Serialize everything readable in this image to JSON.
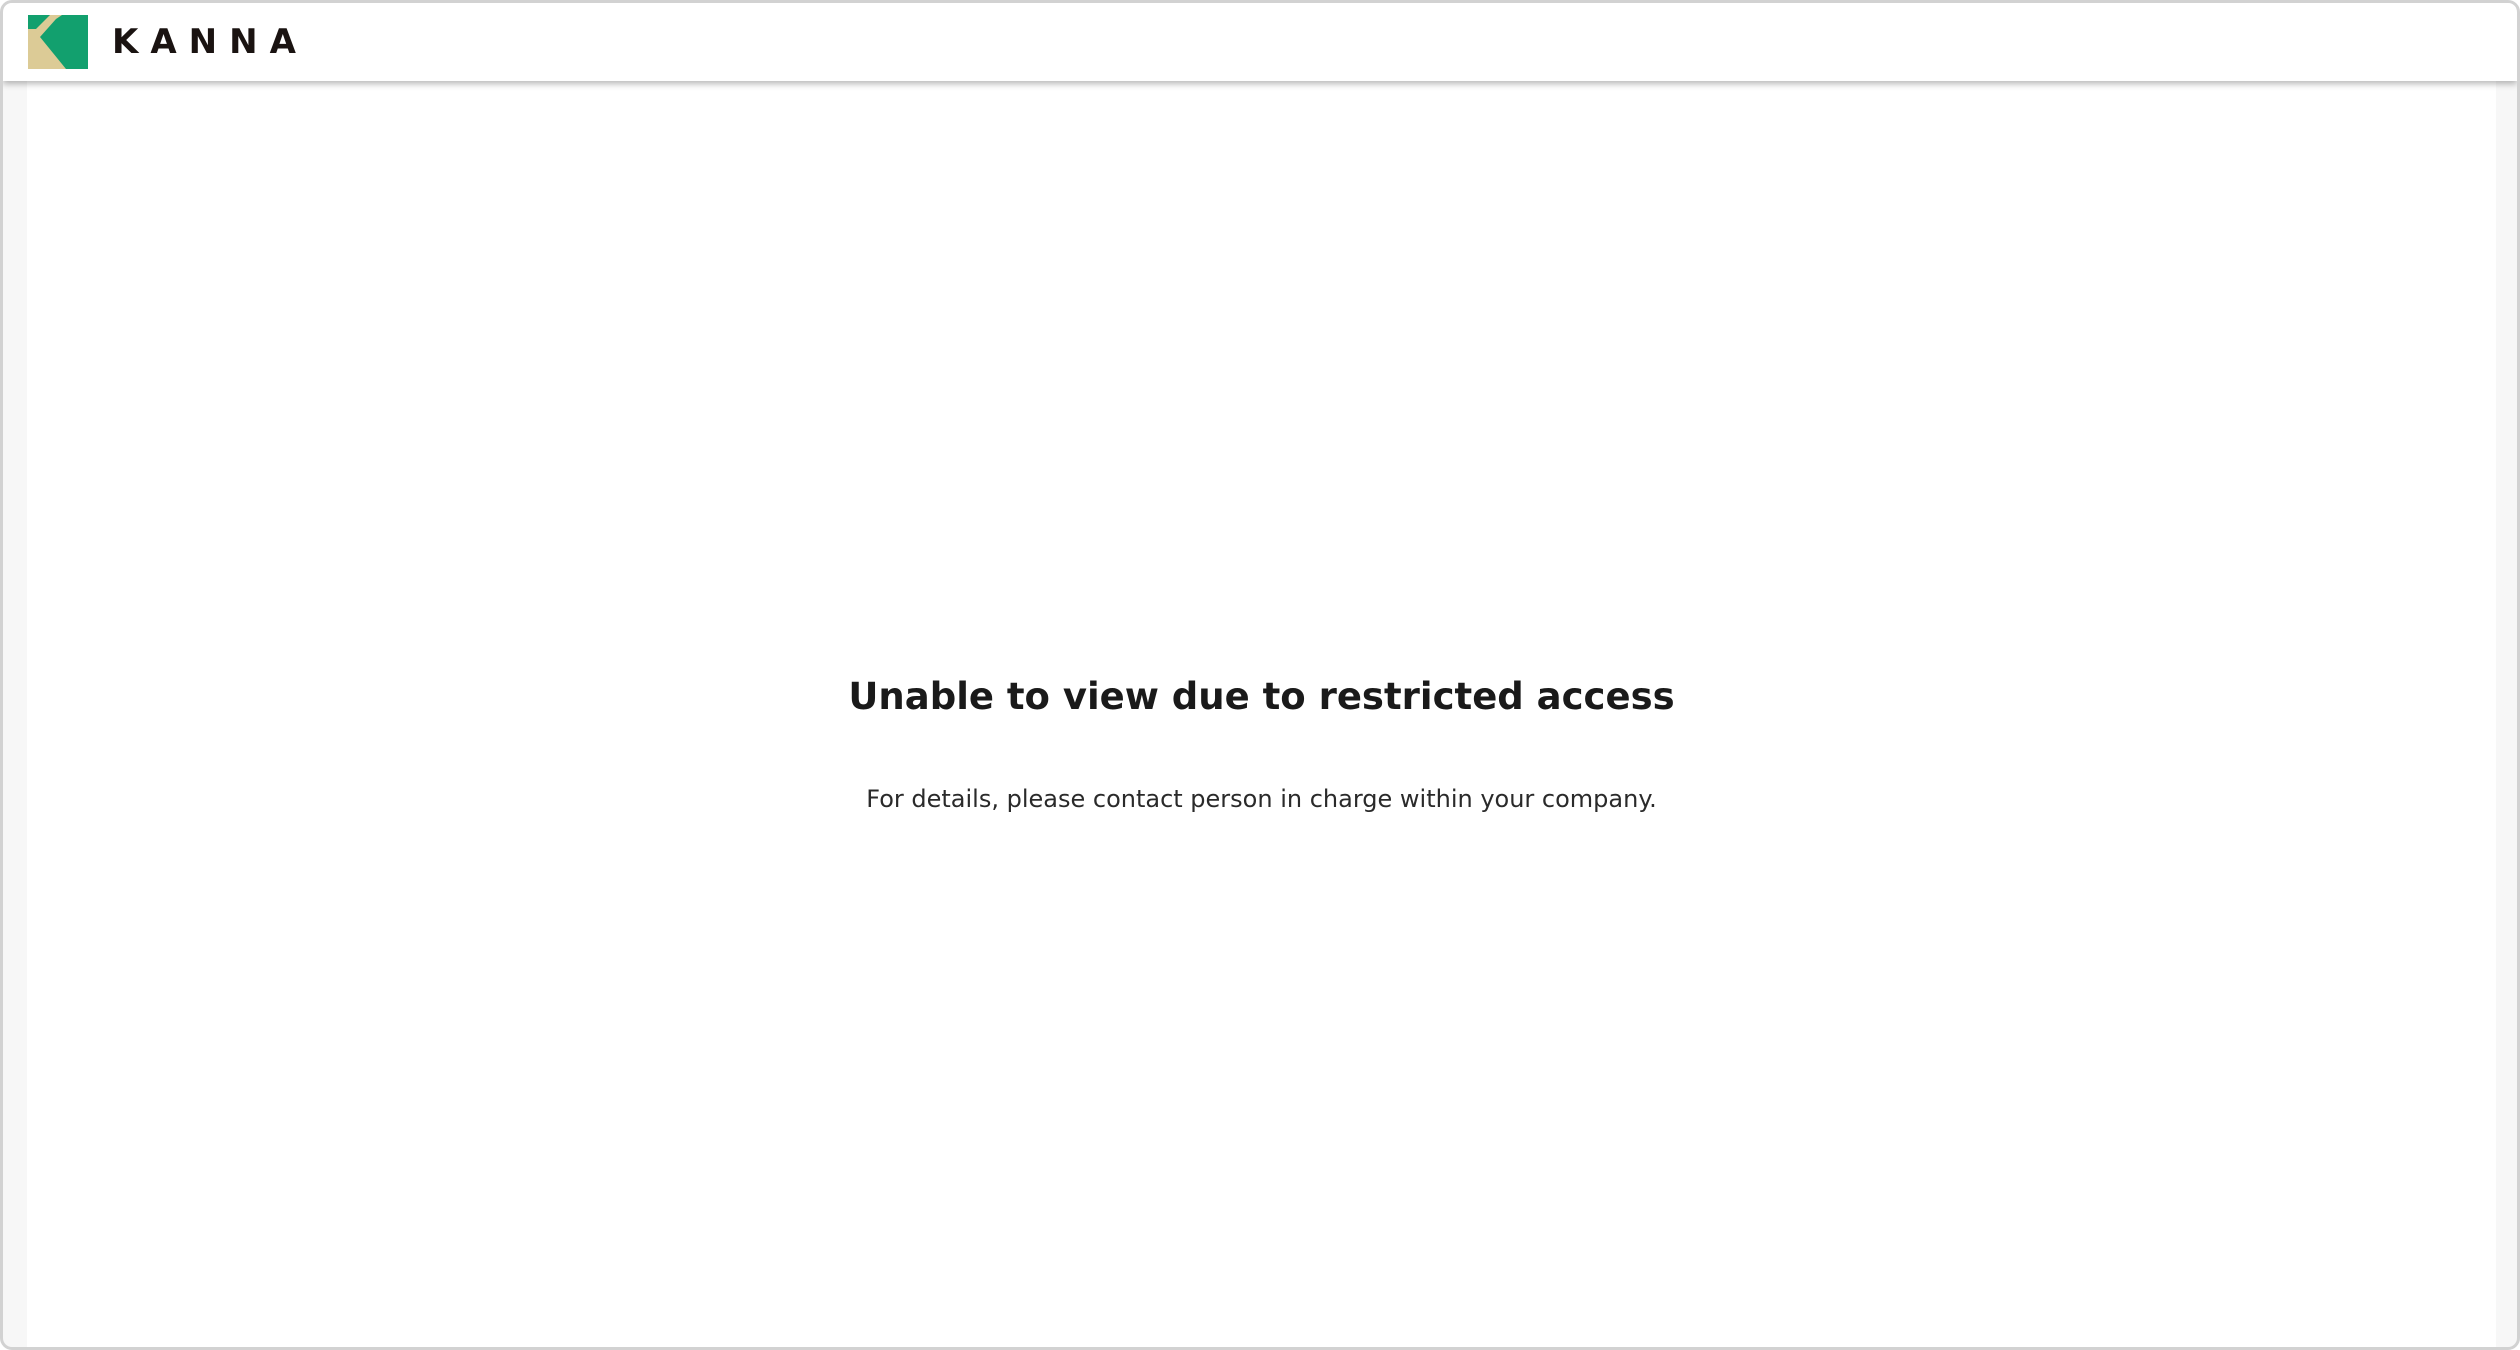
{
  "app": {
    "logo_text": "KANNA",
    "logo_icon": "kanna-logo-icon",
    "brand_colors": {
      "green": "#12a06e",
      "tan": "#dccb96",
      "text": "#1a1311"
    }
  },
  "main": {
    "title": "Unable to view due to restricted access",
    "description": "For details, please contact person in charge within your company."
  }
}
